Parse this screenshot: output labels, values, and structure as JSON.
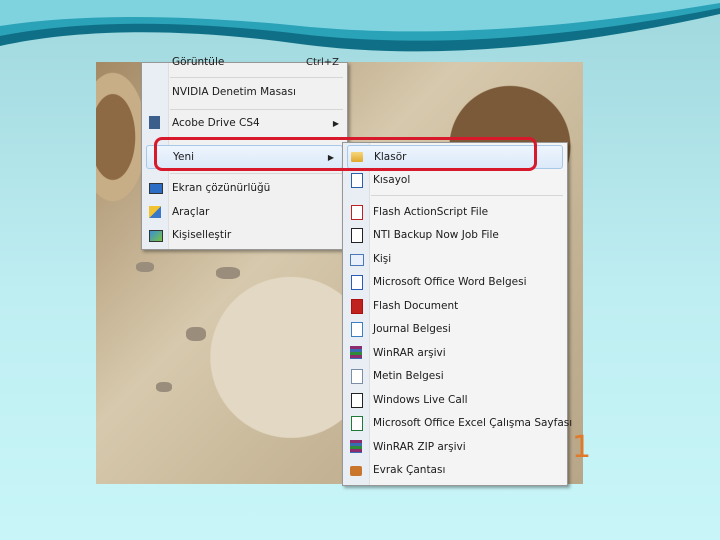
{
  "colors": {
    "highlight_box": "#d8192c",
    "page_number": "#e0792a"
  },
  "page_number": "1",
  "context_menu": {
    "items": [
      {
        "label": "Görüntüle",
        "shortcut": "Ctrl+Z",
        "icon": "none"
      },
      {
        "label": "NVIDIA Denetim Masası",
        "icon": "none"
      },
      {
        "label": "Acobe Drive CS4",
        "icon": "drive-icon",
        "submenu": true
      },
      {
        "label": "Yeni",
        "icon": "none",
        "submenu": true,
        "highlighted": true
      },
      {
        "label": "Ekran çözünürlüğü",
        "icon": "display-icon"
      },
      {
        "label": "Araçlar",
        "icon": "tools-icon"
      },
      {
        "label": "Kişiselleştir",
        "icon": "personalize-icon"
      }
    ]
  },
  "new_submenu": {
    "items": [
      {
        "label": "Klasör",
        "icon": "folder-icon",
        "highlighted": true
      },
      {
        "label": "Kısayol",
        "icon": "shortcut-icon"
      },
      {
        "label": "Flash ActionScript File",
        "icon": "flash-as-icon"
      },
      {
        "label": "NTI Backup Now Job File",
        "icon": "backup-icon"
      },
      {
        "label": "Kişi",
        "icon": "contact-icon"
      },
      {
        "label": "Microsoft Office Word Belgesi",
        "icon": "word-icon"
      },
      {
        "label": "Flash Document",
        "icon": "flash-icon"
      },
      {
        "label": "Journal Belgesi",
        "icon": "journal-icon"
      },
      {
        "label": "WinRAR arşivi",
        "icon": "winrar-icon"
      },
      {
        "label": "Metin Belgesi",
        "icon": "text-doc-icon"
      },
      {
        "label": "Windows Live Call",
        "icon": "live-call-icon"
      },
      {
        "label": "Microsoft Office Excel Çalışma Sayfası",
        "icon": "excel-icon"
      },
      {
        "label": "WinRAR ZIP arşivi",
        "icon": "winrar-zip-icon"
      },
      {
        "label": "Evrak Çantası",
        "icon": "briefcase-icon"
      }
    ]
  }
}
